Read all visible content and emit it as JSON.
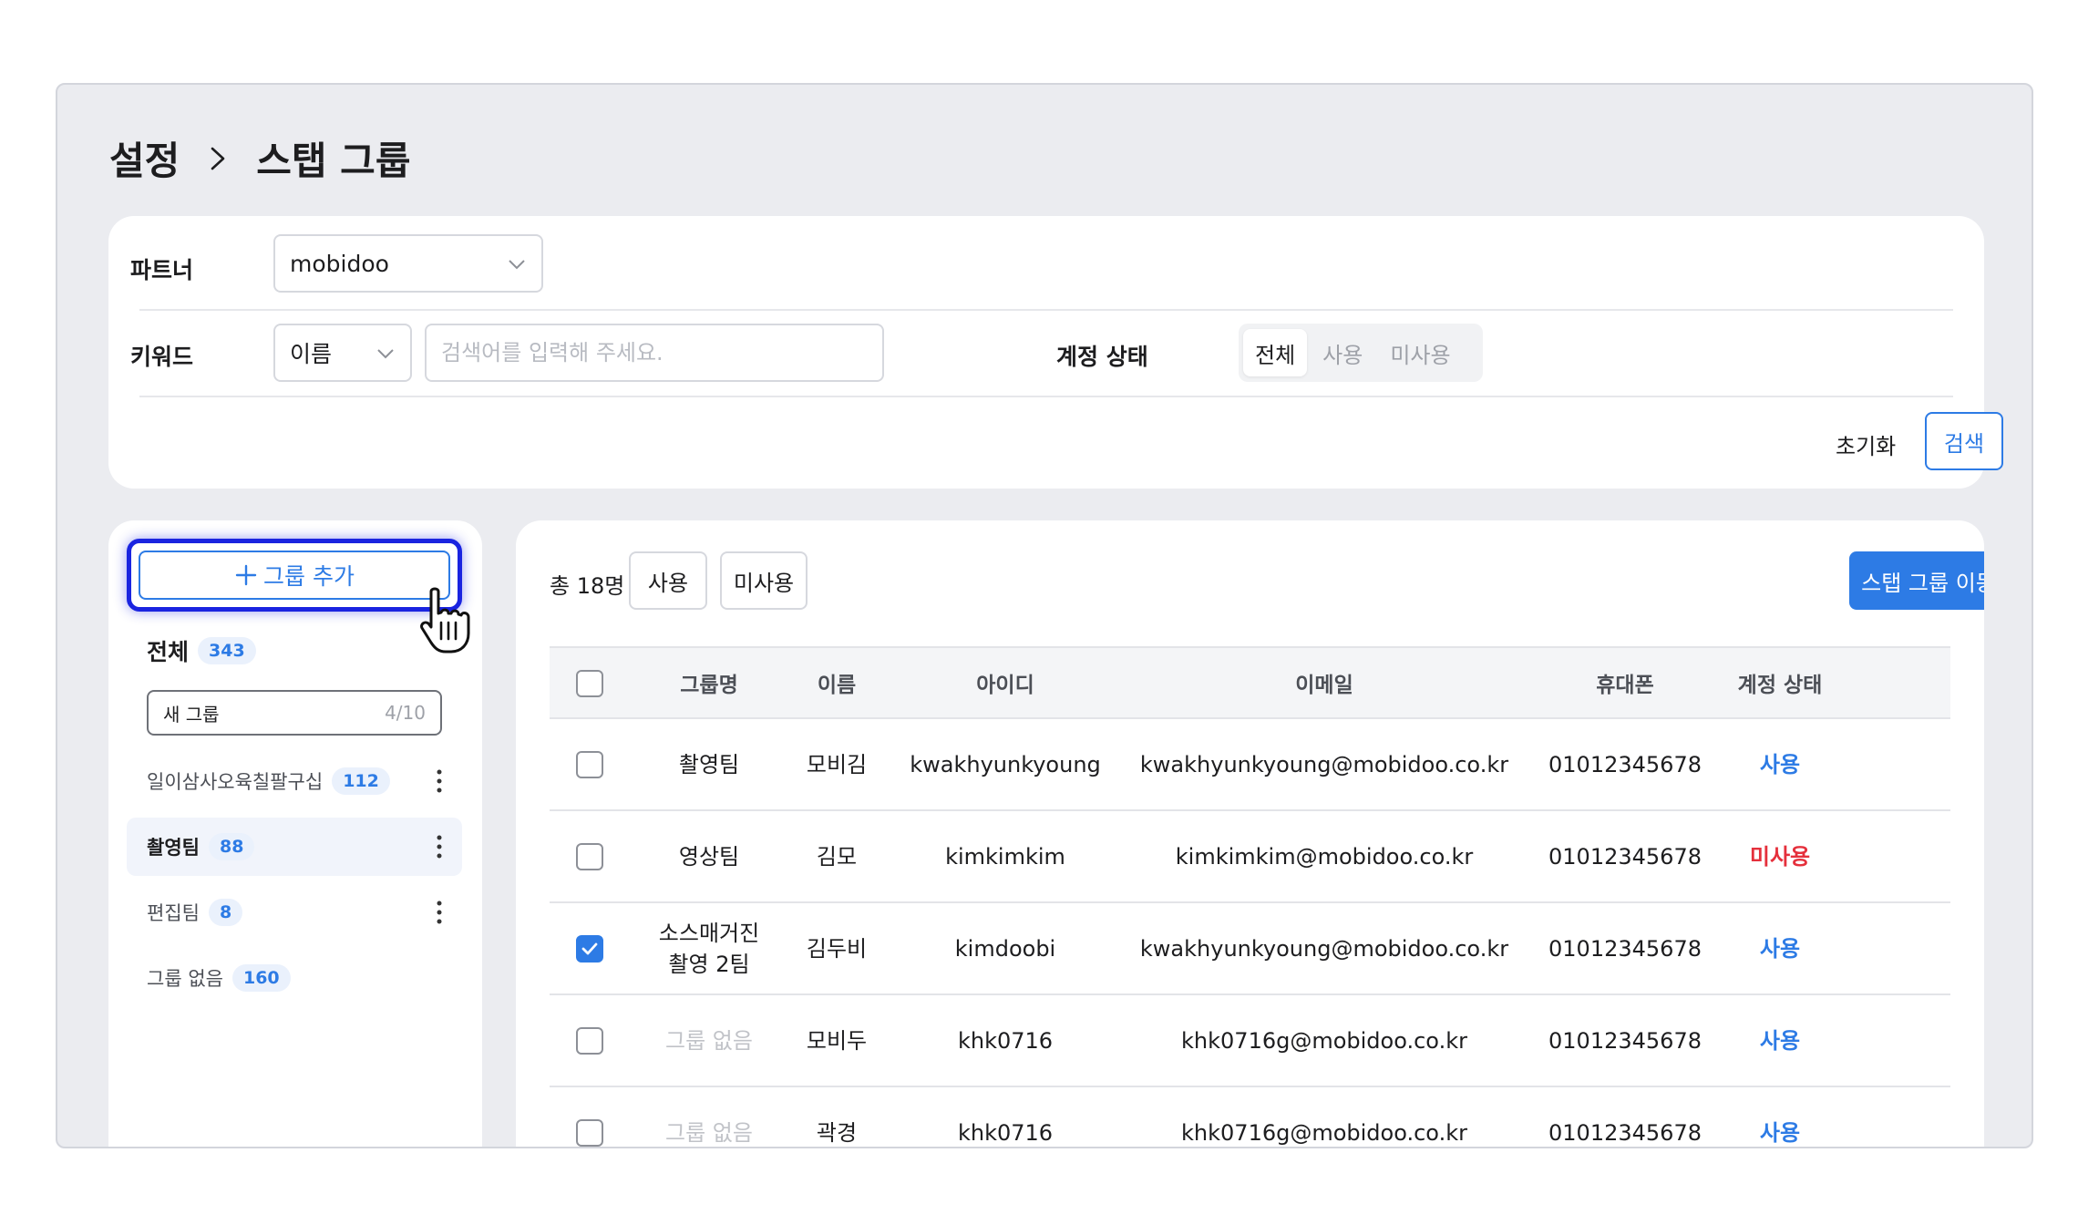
{
  "breadcrumb": {
    "parent": "설정",
    "current": "스탭 그룹"
  },
  "filters": {
    "partner_label": "파트너",
    "partner_value": "mobidoo",
    "keyword_label": "키워드",
    "keyword_type": "이름",
    "keyword_placeholder": "검색어를 입력해 주세요.",
    "status_label": "계정 상태",
    "status_options": [
      "전체",
      "사용",
      "미사용"
    ],
    "status_selected": "전체",
    "reset_label": "초기화",
    "search_label": "검색"
  },
  "groups": {
    "add_label": "그룹 추가",
    "all_label": "전체",
    "all_count": "343",
    "new_group_value": "새 그룹",
    "new_group_counter": "4/10",
    "items": [
      {
        "name": "일이삼사오육칠팔구십",
        "count": "112"
      },
      {
        "name": "촬영팀",
        "count": "88"
      },
      {
        "name": "편집팀",
        "count": "8"
      },
      {
        "name": "그룹 없음",
        "count": "160"
      }
    ]
  },
  "table": {
    "total_text": "총 18명",
    "filter_use": "사용",
    "filter_unused": "미사용",
    "move_label": "스탭 그룹 이동",
    "columns": [
      "그룹명",
      "이름",
      "아이디",
      "이메일",
      "휴대폰",
      "계정 상태"
    ],
    "rows": [
      {
        "group": "촬영팀",
        "group2": "",
        "name": "모비김",
        "id": "kwakhyunkyoung",
        "email": "kwakhyunkyoung@mobidoo.co.kr",
        "phone": "01012345678",
        "status": "사용"
      },
      {
        "group": "영상팀",
        "group2": "",
        "name": "김모",
        "id": "kimkimkim",
        "email": "kimkimkim@mobidoo.co.kr",
        "phone": "01012345678",
        "status": "미사용"
      },
      {
        "group": "소스매거진",
        "group2": "촬영 2팀",
        "name": "김두비",
        "id": "kimdoobi",
        "email": "kwakhyunkyoung@mobidoo.co.kr",
        "phone": "01012345678",
        "status": "사용"
      },
      {
        "group": "그룹 없음",
        "group2": "",
        "name": "모비두",
        "id": "khk0716",
        "email": "khk0716g@mobidoo.co.kr",
        "phone": "01012345678",
        "status": "사용"
      },
      {
        "group": "그룹 없음",
        "group2": "",
        "name": "곽경",
        "id": "khk0716",
        "email": "khk0716g@mobidoo.co.kr",
        "phone": "01012345678",
        "status": "사용"
      }
    ]
  },
  "colors": {
    "accent": "#2d7be5",
    "danger": "#e5303c",
    "highlight": "#1a24e0"
  }
}
